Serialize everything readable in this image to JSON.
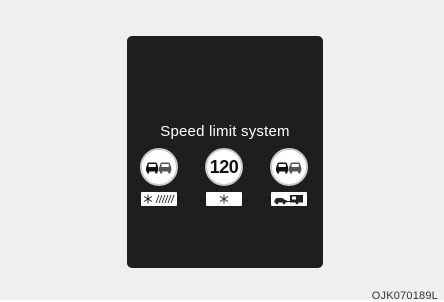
{
  "display": {
    "title": "Speed limit system",
    "signs": [
      {
        "type": "no-overtaking",
        "supplementary": "snow-rain"
      },
      {
        "type": "speed-limit",
        "value": "120",
        "supplementary": "snow"
      },
      {
        "type": "no-overtaking",
        "supplementary": "car-trailer"
      }
    ]
  },
  "caption": "OJK070189L",
  "colors": {
    "background": "#efefef",
    "display": "#1e1e1e",
    "sign": "#ffffff"
  }
}
